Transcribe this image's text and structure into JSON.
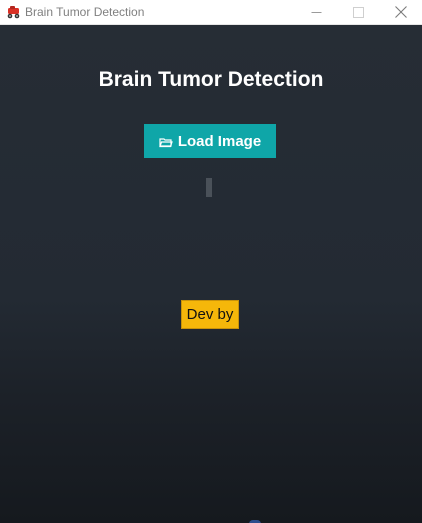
{
  "window": {
    "title": "Brain Tumor Detection",
    "app_icon": "red-vehicle-app-icon",
    "controls": [
      "minimize-icon",
      "maximize-icon",
      "close-icon"
    ]
  },
  "main": {
    "heading": "Brain Tumor Detection",
    "load_button": {
      "label": "Load Image",
      "icon": "folder-open-icon"
    },
    "dev_button": {
      "label": "Dev by"
    }
  },
  "colors": {
    "background_top": "#262d35",
    "background_bottom": "#15191e",
    "load_button": "#0fa6a8",
    "dev_button": "#f5b70a",
    "heading_text": "#ffffff"
  }
}
